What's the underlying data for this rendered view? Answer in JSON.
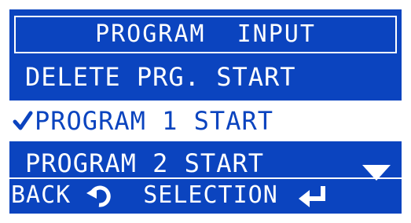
{
  "screen": {
    "title": "PROGRAM  INPUT",
    "items": [
      {
        "label": "DELETE PRG. START",
        "selected": false
      },
      {
        "label": "PROGRAM 1 START",
        "selected": true,
        "check_icon": "checkmark-icon"
      },
      {
        "label": "PROGRAM 2 START",
        "selected": false
      }
    ],
    "scroll_icon": "down-triangle-icon",
    "footer": {
      "back_label": "BACK",
      "back_icon": "back-arrow-icon",
      "selection_label": "SELECTION",
      "enter_icon": "enter-icon"
    }
  },
  "colors": {
    "background": "#0B44BF",
    "foreground": "#FFFFFF"
  }
}
